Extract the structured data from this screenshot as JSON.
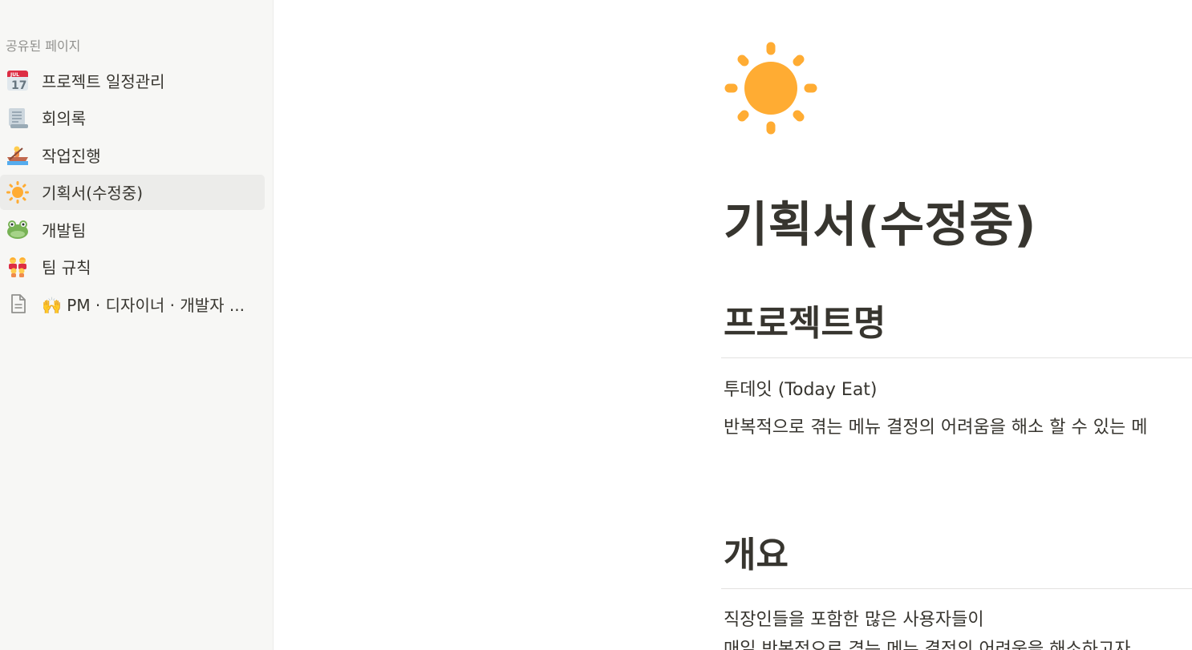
{
  "sidebar": {
    "section_label": "공유된 페이지",
    "items": [
      {
        "label": "프로젝트 일정관리",
        "icon": "calendar-icon"
      },
      {
        "label": "회의록",
        "icon": "scroll-page-icon"
      },
      {
        "label": "작업진행",
        "icon": "rowboat-icon"
      },
      {
        "label": "기획서(수정중)",
        "icon": "sun-icon",
        "active": true
      },
      {
        "label": "개발팀",
        "icon": "frog-icon"
      },
      {
        "label": "팀 규칙",
        "icon": "family-icon"
      },
      {
        "label": "🙌 PM · 디자이너 · 개발자 ...",
        "icon": "document-icon"
      }
    ]
  },
  "page": {
    "icon": "sun-icon",
    "title": "기획서(수정중)",
    "sections": [
      {
        "heading": "프로젝트명",
        "paragraphs": [
          "투데잇 (Today Eat)",
          "반복적으로 겪는 메뉴 결정의 어려움을 해소 할 수 있는 메"
        ]
      },
      {
        "heading": "개요",
        "paragraphs": [
          "직장인들을 포함한 많은 사용자들이",
          "매일 반복적으로 겪는 메뉴 결정의 어려움을 해소하고자"
        ]
      }
    ]
  },
  "colors": {
    "sidebar_bg": "#f7f7f5",
    "active_item_bg": "#ececea",
    "text": "#37352f",
    "muted_text": "#91918e",
    "sun": "#ffac33"
  }
}
